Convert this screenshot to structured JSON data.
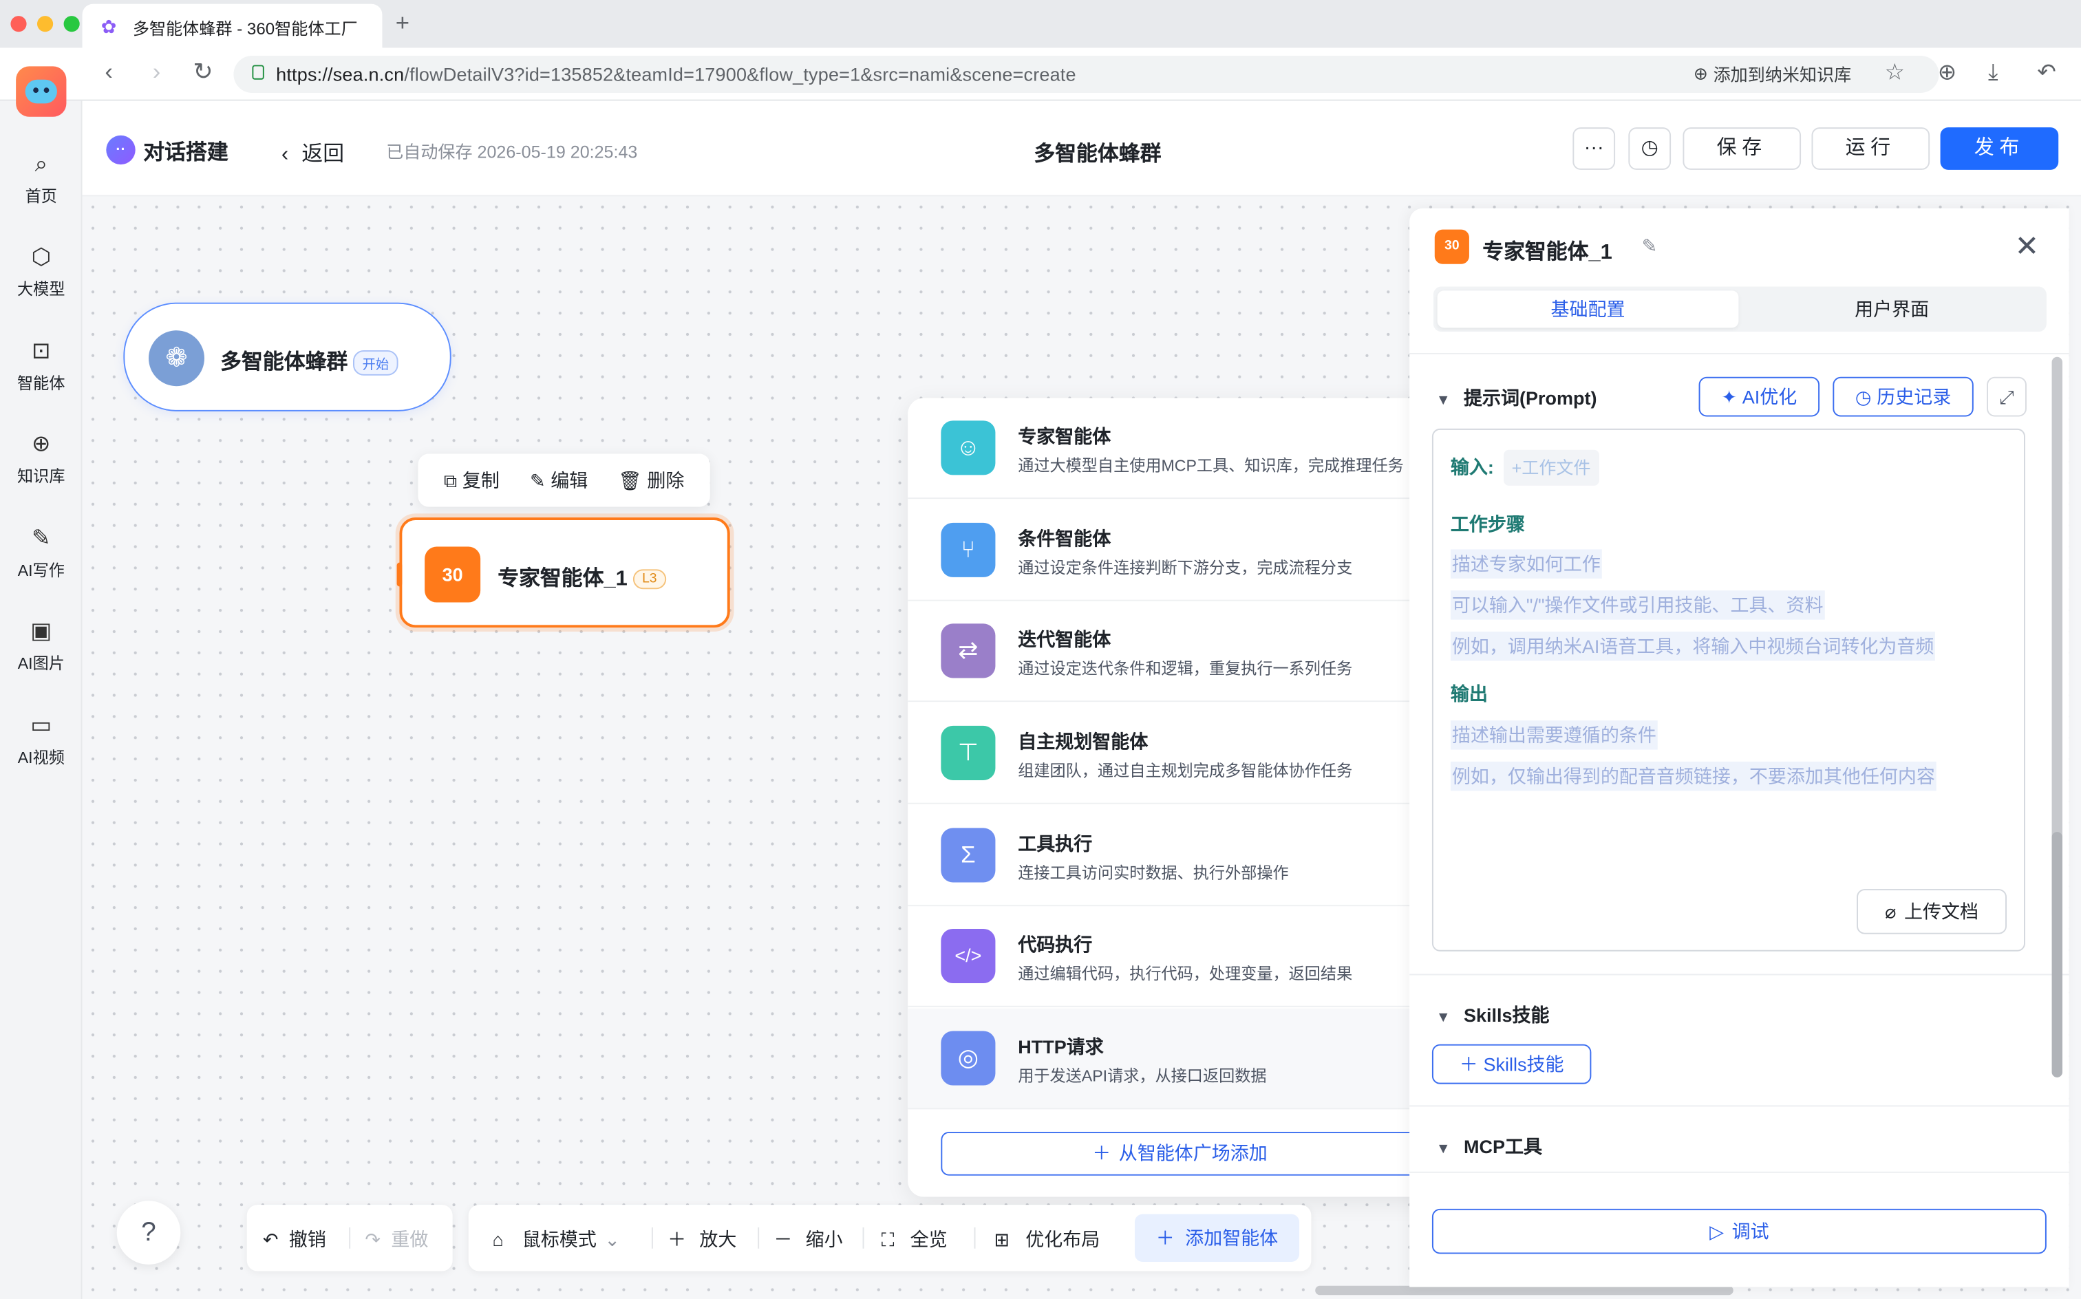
{
  "browser": {
    "tab_title": "多智能体蜂群 - 360智能体工厂",
    "new_tab": "+",
    "url_host": "https://sea.n.cn",
    "url_path": "/flowDetailV3?id=135852&teamId=17900&flow_type=1&src=nami&scene=create",
    "bookmark_label": "添加到纳米知识库",
    "traffic_lights": [
      "#ff5f57",
      "#febc2e",
      "#28c840"
    ]
  },
  "sidebar": {
    "items": [
      {
        "label": "首页",
        "icon": "search-icon"
      },
      {
        "label": "大模型",
        "icon": "cube-icon"
      },
      {
        "label": "智能体",
        "icon": "bot-icon"
      },
      {
        "label": "知识库",
        "icon": "bulb-icon"
      },
      {
        "label": "AI写作",
        "icon": "pen-icon"
      },
      {
        "label": "AI图片",
        "icon": "image-icon"
      },
      {
        "label": "AI视频",
        "icon": "video-icon"
      }
    ]
  },
  "header": {
    "brand": "对话搭建",
    "back": "返回",
    "autosave": "已自动保存 2026-05-19 20:25:43",
    "title": "多智能体蜂群",
    "more": "···",
    "save": "保存",
    "run": "运行",
    "publish": "发布",
    "accent": "#1f6bff"
  },
  "canvas": {
    "start_node": {
      "name": "多智能体蜂群",
      "tag": "开始"
    },
    "node_toolbar": {
      "copy": "复制",
      "edit": "编辑",
      "delete": "删除"
    },
    "expert_node": {
      "name": "专家智能体_1",
      "tag": "L3",
      "icon_text": "30"
    }
  },
  "agent_menu": {
    "items": [
      {
        "title": "专家智能体",
        "desc": "通过大模型自主使用MCP工具、知识库，完成推理任务",
        "color": "#3bc3d6",
        "icon": "robot-icon"
      },
      {
        "title": "条件智能体",
        "desc": "通过设定条件连接判断下游分支，完成流程分支",
        "color": "#4f9ef0",
        "icon": "branch-icon"
      },
      {
        "title": "迭代智能体",
        "desc": "通过设定迭代条件和逻辑，重复执行一系列任务",
        "color": "#9a7fc9",
        "icon": "loop-icon"
      },
      {
        "title": "自主规划智能体",
        "desc": "组建团队，通过自主规划完成多智能体协作任务",
        "color": "#3cc8a8",
        "icon": "signpost-icon"
      },
      {
        "title": "工具执行",
        "desc": "连接工具访问实时数据、执行外部操作",
        "color": "#6f8ff0",
        "icon": "sigma-icon"
      },
      {
        "title": "代码执行",
        "desc": "通过编辑代码，执行代码，处理变量，返回结果",
        "color": "#8b6cf0",
        "icon": "code-icon"
      },
      {
        "title": "HTTP请求",
        "desc": "用于发送API请求，从接口返回数据",
        "color": "#6d8df0",
        "icon": "globe-icon"
      }
    ],
    "add_from_plaza": "从智能体广场添加"
  },
  "bottom_toolbar": {
    "help": "?",
    "undo": "撤销",
    "redo": "重做",
    "mouse_mode": "鼠标模式",
    "zoom_in": "放大",
    "zoom_out": "缩小",
    "fit": "全览",
    "optimize": "优化布局",
    "add_agent": "添加智能体"
  },
  "panel": {
    "title": "专家智能体_1",
    "icon_text": "30",
    "tabs": [
      "基础配置",
      "用户界面"
    ],
    "prompt_section": "提示词(Prompt)",
    "ai_optimize": "AI优化",
    "history": "历史记录",
    "input_label": "输入:",
    "input_chip": "+工作文件",
    "steps_heading": "工作步骤",
    "step_lines": [
      "描述专家如何工作",
      "可以输入\"/\"操作文件或引用技能、工具、资料",
      "例如，调用纳米AI语音工具，将输入中视频台词转化为音频"
    ],
    "output_heading": "输出",
    "output_lines": [
      "描述输出需要遵循的条件",
      "例如，仅输出得到的配音音频链接，不要添加其他任何内容"
    ],
    "upload": "上传文档",
    "skills_section": "Skills技能",
    "skills_button": "Skills技能",
    "mcp_section": "MCP工具",
    "debug": "调试"
  }
}
